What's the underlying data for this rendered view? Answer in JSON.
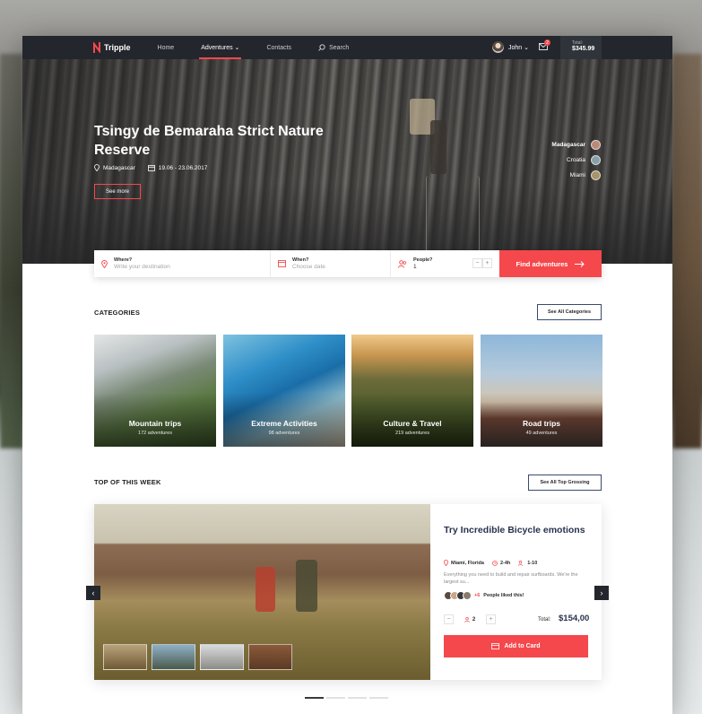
{
  "nav": {
    "logo": "Tripple",
    "links": [
      {
        "label": "Home"
      },
      {
        "label": "Adventures ⌄"
      },
      {
        "label": "Contacts"
      }
    ],
    "search_label": "Search",
    "user_name": "John ⌄",
    "mail_count": "2",
    "cart_label": "Total:",
    "cart_total": "$345.99"
  },
  "hero": {
    "title": "Tsingy de Bemaraha Strict Nature Reserve",
    "location": "Madagascar",
    "dates": "19.06 - 23.06.2017",
    "see_more": "See more",
    "destinations": [
      {
        "label": "Madagascar",
        "color": "#b98a7a"
      },
      {
        "label": "Croatia",
        "color": "#8aa0a8"
      },
      {
        "label": "Miami",
        "color": "#a6946a"
      }
    ]
  },
  "search": {
    "where_label": "Where?",
    "where_placeholder": "Write your destination",
    "when_label": "When?",
    "when_placeholder": "Choose date",
    "people_label": "People?",
    "people_value": "1",
    "minus": "−",
    "plus": "+",
    "find_button": "Find adventures"
  },
  "categories": {
    "title": "CATEGORIES",
    "see_all": "See All Categories",
    "items": [
      {
        "name": "Mountain trips",
        "count": "172 adventures"
      },
      {
        "name": "Extreme Activities",
        "count": "98 adventures"
      },
      {
        "name": "Culture & Travel",
        "count": "219 adventures"
      },
      {
        "name": "Road trips",
        "count": "49 adventures"
      }
    ]
  },
  "top_week": {
    "title": "TOP OF THIS WEEK",
    "see_all": "See All Top Grossing",
    "feature": {
      "title": "Try Incredible Bicycle emotions",
      "location": "Miami, Florida",
      "duration": "2-4h",
      "group": "1-10",
      "description": "Everything you need to build and repair surfboards. We're the largest su...",
      "likes_extra": "+6",
      "likes_text": "People liked this!",
      "qty_minus": "−",
      "qty_value": "2",
      "qty_plus": "+",
      "total_label": "Total:",
      "total_value": "$154,00",
      "add_button": "Add to Card"
    },
    "prev": "‹",
    "next": "›"
  },
  "colors": {
    "accent": "#f5484c",
    "nav_bg": "#23262c",
    "heading": "#27324d"
  }
}
